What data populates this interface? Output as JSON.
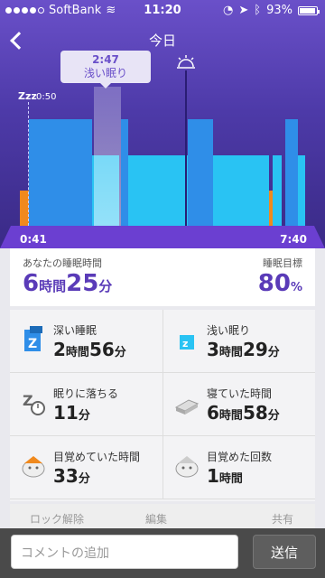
{
  "status_bar": {
    "carrier": "SoftBank",
    "time": "11:20",
    "battery": "93%"
  },
  "header": {
    "title": "今日"
  },
  "tooltip": {
    "time": "2:47",
    "label": "浅い眠り"
  },
  "chart": {
    "start_marker_time": "0:50",
    "axis_start": "0:41",
    "axis_end": "7:40"
  },
  "summary": {
    "sleep_time_label": "あなたの睡眠時間",
    "hours": "6",
    "hours_unit": "時間",
    "minutes": "25",
    "minutes_unit": "分",
    "goal_label": "睡眠目標",
    "goal_value": "80",
    "goal_unit": "%"
  },
  "stats": [
    {
      "label": "深い睡眠",
      "v1": "2",
      "u1": "時間",
      "v2": "56",
      "u2": "分"
    },
    {
      "label": "浅い眠り",
      "v1": "3",
      "u1": "時間",
      "v2": "29",
      "u2": "分"
    },
    {
      "label": "眠りに落ちる",
      "v1": "11",
      "u1": "分",
      "v2": "",
      "u2": ""
    },
    {
      "label": "寝ていた時間",
      "v1": "6",
      "u1": "時間",
      "v2": "58",
      "u2": "分"
    },
    {
      "label": "目覚めていた時間",
      "v1": "33",
      "u1": "分",
      "v2": "",
      "u2": ""
    },
    {
      "label": "目覚めた回数",
      "v1": "1",
      "u1": "時間",
      "v2": "",
      "u2": ""
    }
  ],
  "toolbar": {
    "lock": "ロック解除",
    "edit": "編集",
    "share": "共有"
  },
  "footer": {
    "comment_placeholder": "コメントの追加",
    "send_label": "送信"
  },
  "colors": {
    "deep": "#2f8ee8",
    "light": "#29c3f3",
    "awake": "#f0891d",
    "accent": "#5a3bb8"
  }
}
